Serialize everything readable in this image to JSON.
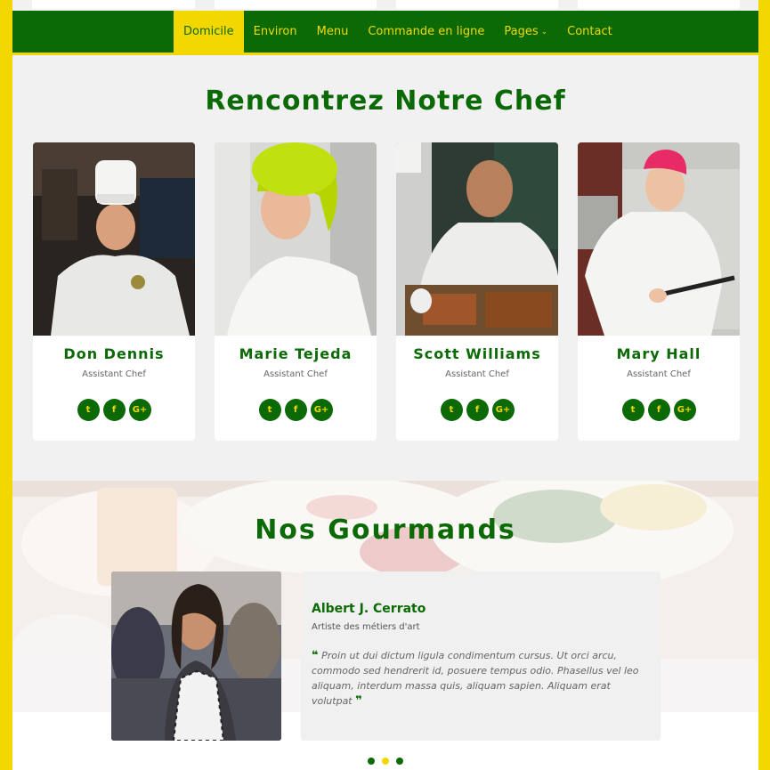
{
  "nav": {
    "items": [
      {
        "label": "Domicile",
        "active": true
      },
      {
        "label": "Environ"
      },
      {
        "label": "Menu"
      },
      {
        "label": "Commande en ligne"
      },
      {
        "label": "Pages",
        "dropdown": true
      },
      {
        "label": "Contact"
      }
    ],
    "caret_icon": "chevron-down-icon"
  },
  "chefs": {
    "title": "Rencontrez Notre Chef",
    "members": [
      {
        "name": "Don Dennis",
        "role": "Assistant Chef"
      },
      {
        "name": "Marie Tejeda",
        "role": "Assistant Chef"
      },
      {
        "name": "Scott Williams",
        "role": "Assistant Chef"
      },
      {
        "name": "Mary Hall",
        "role": "Assistant Chef"
      }
    ],
    "social_icons": [
      "twitter-icon",
      "facebook-icon",
      "google-plus-icon"
    ],
    "social_glyphs": [
      "t",
      "f",
      "G+"
    ]
  },
  "gourmets": {
    "title": "Nos Gourmands",
    "testimonial": {
      "name": "Albert J. Cerrato",
      "role": "Artiste des métiers d'art",
      "open_quote": "❝",
      "close_quote": "❞",
      "quote": "Proin ut dui dictum ligula condimentum cursus. Ut orci arcu, commodo sed hendrerit id, posuere tempus odio. Phasellus vel leo aliquam, interdum massa quis, aliquam sapien. Aliquam erat volutpat"
    },
    "carousel_dots": 3,
    "active_dot": 1
  },
  "colors": {
    "brand_green": "#0b6a06",
    "brand_yellow": "#f2d800",
    "page_bg": "#f1f1f1"
  }
}
